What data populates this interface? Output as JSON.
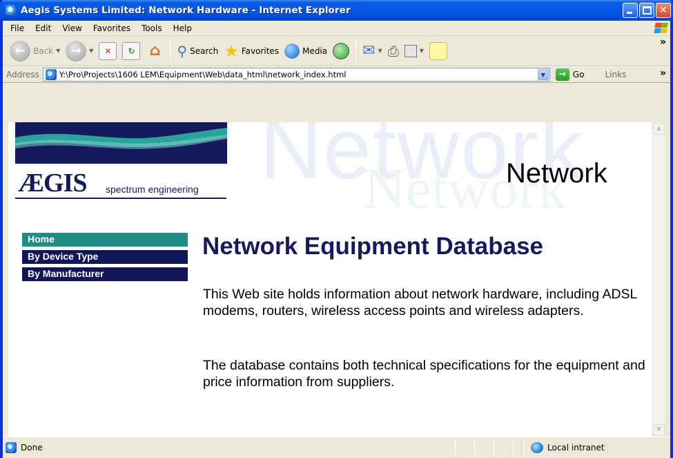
{
  "window": {
    "title": "Aegis Systems Limited: Network Hardware - Internet Explorer"
  },
  "menu": {
    "items": [
      {
        "label": "File"
      },
      {
        "label": "Edit"
      },
      {
        "label": "View"
      },
      {
        "label": "Favorites"
      },
      {
        "label": "Tools"
      },
      {
        "label": "Help"
      }
    ]
  },
  "toolbar": {
    "back_label": "Back",
    "search_label": "Search",
    "favorites_label": "Favorites",
    "media_label": "Media"
  },
  "address": {
    "label": "Address",
    "url": "Y:\\Pro\\Projects\\1606 LEM\\Equipment\\Web\\data_html\\network_index.html",
    "go_label": "Go",
    "links_label": "Links"
  },
  "page": {
    "logo_text": "ÆGIS",
    "logo_subtitle": "spectrum engineering",
    "section_title": "Network",
    "watermark_text": "Network",
    "nav": [
      {
        "label": "Home",
        "active": true
      },
      {
        "label": "By Device Type",
        "active": false
      },
      {
        "label": "By Manufacturer",
        "active": false
      }
    ],
    "heading": "Network Equipment Database",
    "paragraphs": [
      "This Web site holds information about network hardware, including ADSL modems, routers, wireless access points and wireless adapters.",
      "The database contains both technical specifications for the equipment and price information from suppliers."
    ]
  },
  "status": {
    "text": "Done",
    "zone": "Local intranet"
  },
  "colors": {
    "heading": "#17195c",
    "nav_active": "#1f8c86",
    "nav_inactive": "#121556",
    "title_bar": "#0456e3"
  }
}
